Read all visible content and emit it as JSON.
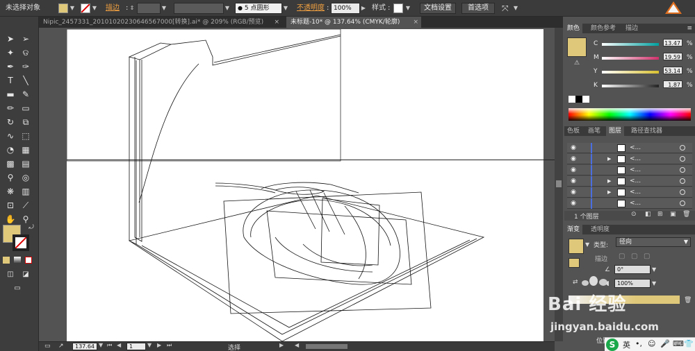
{
  "controlbar": {
    "selection_label": "未选择对象",
    "stroke_label": "描边",
    "brush_label": "5 点圆形",
    "opacity_label": "不透明度",
    "opacity_value": "100%",
    "style_label": "样式",
    "doc_settings_button": "文档设置",
    "preferences_button": "首选项",
    "fill_color": "#e0c87a"
  },
  "tabs": [
    {
      "label": "Nipic_2457331_20101020230646567000[转换].ai* @ 209% (RGB/预览)"
    },
    {
      "label": "未标题-10* @ 137.64% (CMYK/轮廓)"
    }
  ],
  "statusbar": {
    "zoom": "137.64",
    "page": "1",
    "tool_name": "选择"
  },
  "color_panel": {
    "tabs": [
      "颜色",
      "颜色参考",
      "描边"
    ],
    "channels": [
      {
        "name": "C",
        "value": "13.47",
        "color": "#00a0a0"
      },
      {
        "name": "M",
        "value": "19.59",
        "color": "#d0306a"
      },
      {
        "name": "Y",
        "value": "53.14",
        "color": "#d8c030"
      },
      {
        "name": "K",
        "value": "1.87",
        "color": "#333333"
      }
    ],
    "swatch_color": "#e0c87a"
  },
  "layers_panel": {
    "tabs": [
      "色板",
      "画笔",
      "图层",
      "路径查找器"
    ],
    "row_label": "<...",
    "footer": "1 个图层"
  },
  "gradient_panel": {
    "tabs": [
      "渐变",
      "透明度"
    ],
    "type_label": "类型:",
    "type_value": "径向",
    "stroke_label": "描边",
    "angle_value": "0°",
    "ratio_value": "100%",
    "position_label": "位置"
  },
  "watermark": {
    "logo": "Bai 经验",
    "url": "jingyan.baidu.com"
  },
  "ime": {
    "lang": "英"
  }
}
